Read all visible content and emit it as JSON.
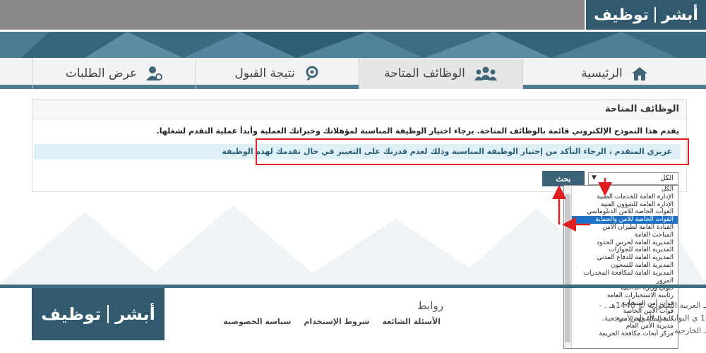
{
  "brand": {
    "logo_text_left": "أبشر",
    "logo_text_right": "توظيف"
  },
  "nav": {
    "tabs": [
      {
        "label": "الرئيسية",
        "icon": "home-icon"
      },
      {
        "label": "الوظائف المتاحة",
        "icon": "group-icon",
        "active": true
      },
      {
        "label": "نتيجة القبول",
        "icon": "result-icon"
      },
      {
        "label": "عرض الطلبات",
        "icon": "user-gear-icon"
      }
    ]
  },
  "panel": {
    "title": "الوظائف المتاحة",
    "intro": "يقدم هذا النموذج الإلكتروني قائمة بالوظائف المتاحة. برجاء اختيار الوظيفة المناسبة لمؤهلاتك وخبراتك العملية وأبدأ عملية التقدم لشغلها.",
    "alert": "عزيزي المتقدم ، الرجاء التأكد من إختيار الوظيفة المناسبة وذلك لعدم قدرتك على التغيير في حال تقدمك لهذه الوظيفة"
  },
  "search": {
    "button_label": "بحث",
    "selected": "الكل",
    "arrow_glyph": "▼",
    "options": [
      "الكل",
      "الإدارة العامة للخدمات الطبية",
      "الإدارة العامة للشؤون الفنية",
      "القوات الخاصة للأمن الدبلوماسي",
      "القوات الخاصة للأمن والحماية",
      "القيادة العامة لطيران الأمن",
      "المباحث العامة",
      "المديرية العامة لحرس الحدود",
      "المديرية العامة للجوازات",
      "المديرية العامة للدفاع المدني",
      "المديرية العامة للسجون",
      "المديرية العامة لمكافحة المخدرات",
      "المرور",
      "ديوان وزارة الداخلية",
      "رئاسة الاستخبارات العامة",
      "قوات أمن المنشآت",
      "قوات الأمن الخاصة",
      "كلية الملك فهد الأمنية",
      "مديرية الأمن العام",
      "مركز أبحاث مكافحة الجريمة"
    ],
    "highlighted_index": 4
  },
  "footer": {
    "links_title": "روابط",
    "links": [
      "الأسئلة الشائعة",
      "شروط الإستخدام",
      "سياسة الخصوصية"
    ],
    "copyright_1": "جـ   العربية السعودية © 1440هـ . -",
    "copyright_2": "18  ي البوابة هي لأغراض مرجعية.",
    "copyright_3": "أبـ  الخارجية."
  },
  "colors": {
    "brand": "#315a6e",
    "accent": "#3b6275",
    "highlight": "#1e73c8",
    "annotation": "#e02020"
  }
}
